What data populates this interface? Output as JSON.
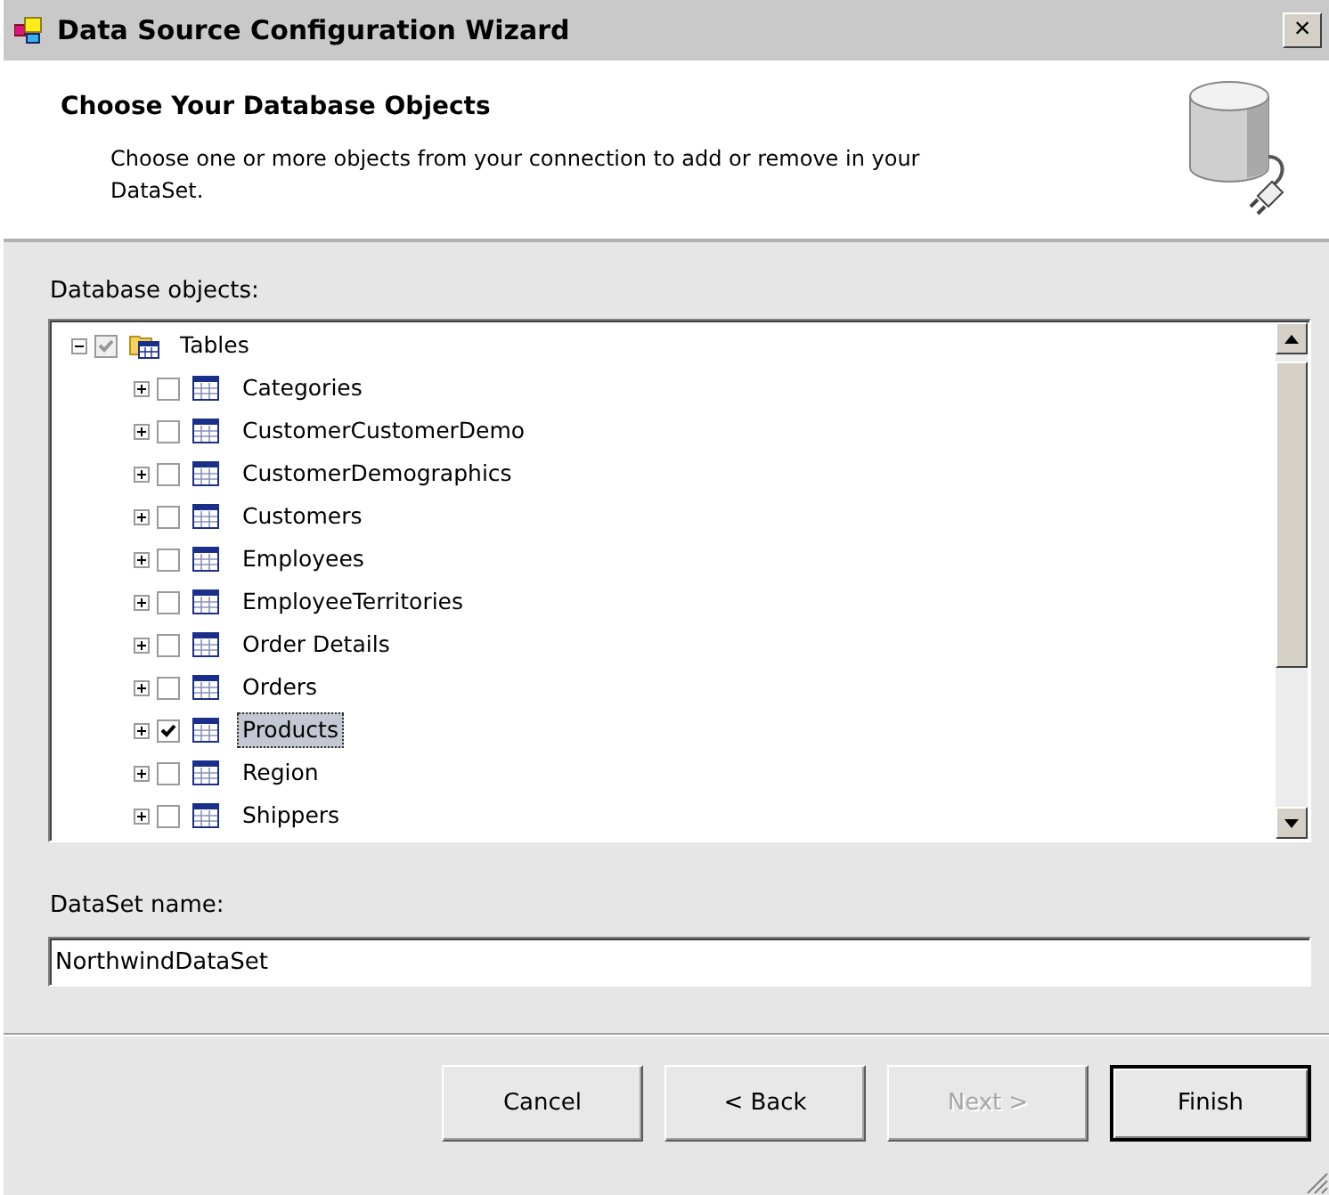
{
  "window": {
    "title": "Data Source Configuration Wizard",
    "close": "×"
  },
  "header": {
    "title": "Choose Your Database Objects",
    "description": "Choose one or more objects from your connection to add or remove in your DataSet."
  },
  "objects_label": {
    "text": "Database objects:"
  },
  "tree": {
    "root": {
      "label": "Tables",
      "expanded": true,
      "checked": true,
      "partial": true,
      "selected": false,
      "children": [
        {
          "label": "Categories",
          "expanded": false,
          "checked": false,
          "selected": false
        },
        {
          "label": "CustomerCustomerDemo",
          "expanded": false,
          "checked": false,
          "selected": false
        },
        {
          "label": "CustomerDemographics",
          "expanded": false,
          "checked": false,
          "selected": false
        },
        {
          "label": "Customers",
          "expanded": false,
          "checked": false,
          "selected": false
        },
        {
          "label": "Employees",
          "expanded": false,
          "checked": false,
          "selected": false
        },
        {
          "label": "EmployeeTerritories",
          "expanded": false,
          "checked": false,
          "selected": false
        },
        {
          "label": "Order Details",
          "expanded": false,
          "checked": false,
          "selected": false
        },
        {
          "label": "Orders",
          "expanded": false,
          "checked": false,
          "selected": false
        },
        {
          "label": "Products",
          "expanded": false,
          "checked": true,
          "selected": true
        },
        {
          "label": "Region",
          "expanded": false,
          "checked": false,
          "selected": false
        },
        {
          "label": "Shippers",
          "expanded": false,
          "checked": false,
          "selected": false
        }
      ]
    }
  },
  "dataset_label": {
    "text": "DataSet name:"
  },
  "dataset_name": {
    "value": "NorthwindDataSet"
  },
  "buttons": [
    {
      "label": "Cancel",
      "disabled": false,
      "default": false
    },
    {
      "label": "< Back",
      "disabled": false,
      "default": false
    },
    {
      "label": "Next >",
      "disabled": true,
      "default": false
    },
    {
      "label": "Finish",
      "disabled": false,
      "default": true
    }
  ]
}
